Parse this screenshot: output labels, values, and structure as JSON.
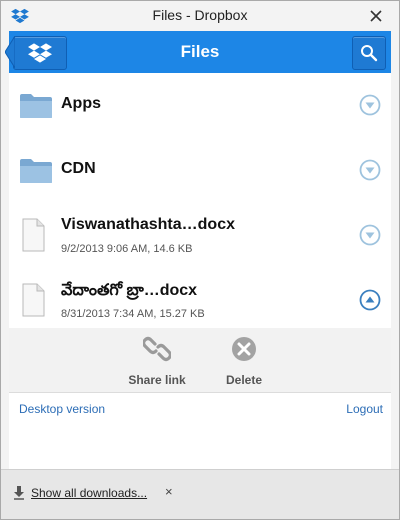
{
  "window": {
    "title": "Files - Dropbox"
  },
  "header": {
    "title": "Files"
  },
  "files": [
    {
      "name": "Apps",
      "meta": "",
      "type": "folder",
      "expanded": false
    },
    {
      "name": "CDN",
      "meta": "",
      "type": "folder",
      "expanded": false
    },
    {
      "name": "Viswanathashta…docx",
      "meta": "9/2/2013 9:06 AM, 14.6 KB",
      "type": "document",
      "expanded": false
    },
    {
      "name": "వేదాంతగో బ్రా…docx",
      "meta": "8/31/2013 7:34 AM, 15.27 KB",
      "type": "document",
      "expanded": true
    }
  ],
  "actions": {
    "share_label": "Share link",
    "delete_label": "Delete"
  },
  "links": {
    "desktop": "Desktop version",
    "logout": "Logout"
  },
  "downloads": {
    "show_all": "Show all downloads...",
    "close": "×"
  },
  "colors": {
    "header": "#1d86e6",
    "link": "#2c6db6",
    "toggle": "#9ec3de",
    "toggle_active": "#3a7fbf",
    "folder": "#8fb8dc"
  }
}
